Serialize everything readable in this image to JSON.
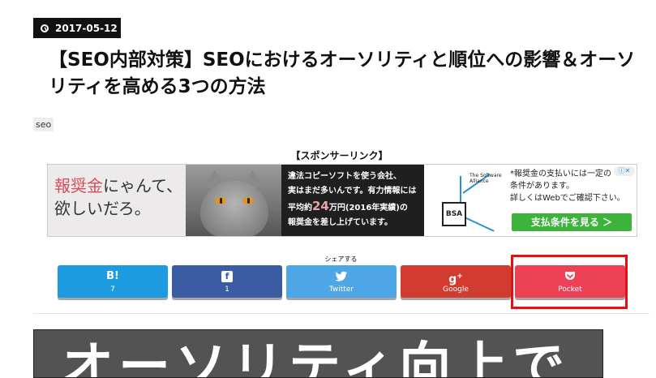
{
  "post": {
    "date": "2017-05-12",
    "title": "【SEO内部対策】SEOにおけるオーソリティと順位への影響＆オーソリティを高める3つの方法",
    "tag": "seo"
  },
  "sponsor": {
    "label": "【スポンサーリンク】"
  },
  "ad": {
    "headline_red": "報奨金",
    "headline_rest": "にゃんて、",
    "headline_line2": "欲しいだろ。",
    "mid_line1": "違法コピーソフトを使う会社、",
    "mid_line2": "実はまだ多いんです。有力情報には",
    "mid_line3_a": "平均約",
    "mid_line3_big": "24",
    "mid_line3_b": "万円(2016年実績)の",
    "mid_line4": "報奨金を差し上げています。",
    "bsa_logo": "BSA",
    "bsa_small": "The Software Alliance",
    "right_line1": "*報奨金の支払いには一定の",
    "right_line2": "条件があります。",
    "right_line3": "詳しくはWebでご確認下さい。",
    "cta": "支払条件を見る ＞",
    "choices": "ⓘ✕"
  },
  "share": {
    "label": "シェアする",
    "buttons": [
      {
        "name": "hatena",
        "icon": "B!",
        "label": "7"
      },
      {
        "name": "facebook",
        "icon": "f",
        "label": "1"
      },
      {
        "name": "twitter",
        "icon": "bird",
        "label": "Twitter"
      },
      {
        "name": "google",
        "icon": "g+",
        "label": "Google"
      },
      {
        "name": "pocket",
        "icon": "pocket",
        "label": "Pocket"
      }
    ]
  },
  "hero": {
    "text": "オーソリティ向上で"
  },
  "colors": {
    "hatena": "#1c9be0",
    "facebook": "#3b5ba3",
    "twitter": "#4fa6e6",
    "google": "#d23c30",
    "pocket": "#ee4155",
    "highlight": "#e21010"
  }
}
